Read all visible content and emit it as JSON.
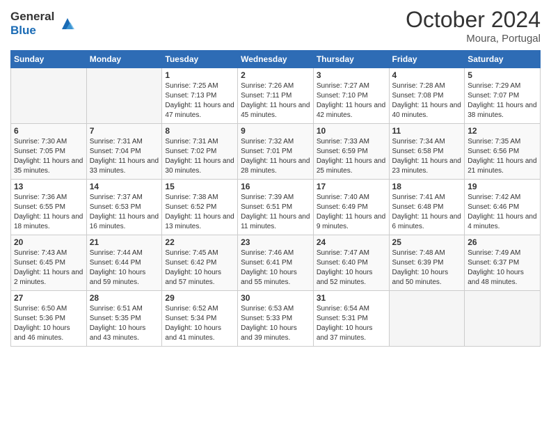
{
  "header": {
    "logo_line1": "General",
    "logo_line2": "Blue",
    "month": "October 2024",
    "location": "Moura, Portugal"
  },
  "days_of_week": [
    "Sunday",
    "Monday",
    "Tuesday",
    "Wednesday",
    "Thursday",
    "Friday",
    "Saturday"
  ],
  "weeks": [
    [
      {
        "day": "",
        "content": ""
      },
      {
        "day": "",
        "content": ""
      },
      {
        "day": "1",
        "content": "Sunrise: 7:25 AM\nSunset: 7:13 PM\nDaylight: 11 hours and 47 minutes."
      },
      {
        "day": "2",
        "content": "Sunrise: 7:26 AM\nSunset: 7:11 PM\nDaylight: 11 hours and 45 minutes."
      },
      {
        "day": "3",
        "content": "Sunrise: 7:27 AM\nSunset: 7:10 PM\nDaylight: 11 hours and 42 minutes."
      },
      {
        "day": "4",
        "content": "Sunrise: 7:28 AM\nSunset: 7:08 PM\nDaylight: 11 hours and 40 minutes."
      },
      {
        "day": "5",
        "content": "Sunrise: 7:29 AM\nSunset: 7:07 PM\nDaylight: 11 hours and 38 minutes."
      }
    ],
    [
      {
        "day": "6",
        "content": "Sunrise: 7:30 AM\nSunset: 7:05 PM\nDaylight: 11 hours and 35 minutes."
      },
      {
        "day": "7",
        "content": "Sunrise: 7:31 AM\nSunset: 7:04 PM\nDaylight: 11 hours and 33 minutes."
      },
      {
        "day": "8",
        "content": "Sunrise: 7:31 AM\nSunset: 7:02 PM\nDaylight: 11 hours and 30 minutes."
      },
      {
        "day": "9",
        "content": "Sunrise: 7:32 AM\nSunset: 7:01 PM\nDaylight: 11 hours and 28 minutes."
      },
      {
        "day": "10",
        "content": "Sunrise: 7:33 AM\nSunset: 6:59 PM\nDaylight: 11 hours and 25 minutes."
      },
      {
        "day": "11",
        "content": "Sunrise: 7:34 AM\nSunset: 6:58 PM\nDaylight: 11 hours and 23 minutes."
      },
      {
        "day": "12",
        "content": "Sunrise: 7:35 AM\nSunset: 6:56 PM\nDaylight: 11 hours and 21 minutes."
      }
    ],
    [
      {
        "day": "13",
        "content": "Sunrise: 7:36 AM\nSunset: 6:55 PM\nDaylight: 11 hours and 18 minutes."
      },
      {
        "day": "14",
        "content": "Sunrise: 7:37 AM\nSunset: 6:53 PM\nDaylight: 11 hours and 16 minutes."
      },
      {
        "day": "15",
        "content": "Sunrise: 7:38 AM\nSunset: 6:52 PM\nDaylight: 11 hours and 13 minutes."
      },
      {
        "day": "16",
        "content": "Sunrise: 7:39 AM\nSunset: 6:51 PM\nDaylight: 11 hours and 11 minutes."
      },
      {
        "day": "17",
        "content": "Sunrise: 7:40 AM\nSunset: 6:49 PM\nDaylight: 11 hours and 9 minutes."
      },
      {
        "day": "18",
        "content": "Sunrise: 7:41 AM\nSunset: 6:48 PM\nDaylight: 11 hours and 6 minutes."
      },
      {
        "day": "19",
        "content": "Sunrise: 7:42 AM\nSunset: 6:46 PM\nDaylight: 11 hours and 4 minutes."
      }
    ],
    [
      {
        "day": "20",
        "content": "Sunrise: 7:43 AM\nSunset: 6:45 PM\nDaylight: 11 hours and 2 minutes."
      },
      {
        "day": "21",
        "content": "Sunrise: 7:44 AM\nSunset: 6:44 PM\nDaylight: 10 hours and 59 minutes."
      },
      {
        "day": "22",
        "content": "Sunrise: 7:45 AM\nSunset: 6:42 PM\nDaylight: 10 hours and 57 minutes."
      },
      {
        "day": "23",
        "content": "Sunrise: 7:46 AM\nSunset: 6:41 PM\nDaylight: 10 hours and 55 minutes."
      },
      {
        "day": "24",
        "content": "Sunrise: 7:47 AM\nSunset: 6:40 PM\nDaylight: 10 hours and 52 minutes."
      },
      {
        "day": "25",
        "content": "Sunrise: 7:48 AM\nSunset: 6:39 PM\nDaylight: 10 hours and 50 minutes."
      },
      {
        "day": "26",
        "content": "Sunrise: 7:49 AM\nSunset: 6:37 PM\nDaylight: 10 hours and 48 minutes."
      }
    ],
    [
      {
        "day": "27",
        "content": "Sunrise: 6:50 AM\nSunset: 5:36 PM\nDaylight: 10 hours and 46 minutes."
      },
      {
        "day": "28",
        "content": "Sunrise: 6:51 AM\nSunset: 5:35 PM\nDaylight: 10 hours and 43 minutes."
      },
      {
        "day": "29",
        "content": "Sunrise: 6:52 AM\nSunset: 5:34 PM\nDaylight: 10 hours and 41 minutes."
      },
      {
        "day": "30",
        "content": "Sunrise: 6:53 AM\nSunset: 5:33 PM\nDaylight: 10 hours and 39 minutes."
      },
      {
        "day": "31",
        "content": "Sunrise: 6:54 AM\nSunset: 5:31 PM\nDaylight: 10 hours and 37 minutes."
      },
      {
        "day": "",
        "content": ""
      },
      {
        "day": "",
        "content": ""
      }
    ]
  ]
}
